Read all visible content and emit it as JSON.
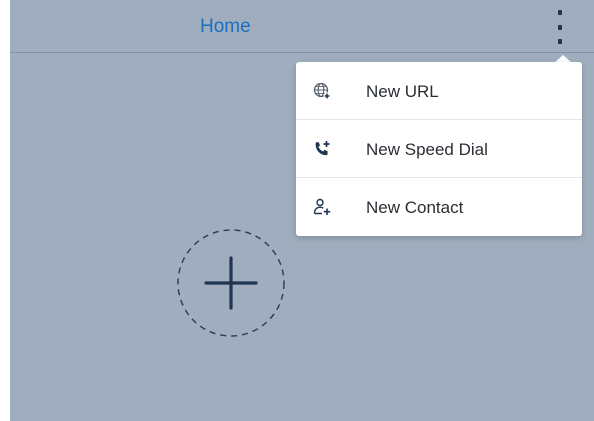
{
  "header": {
    "title": "Home",
    "more_icon": "vertical-ellipsis-icon"
  },
  "menu": {
    "items": [
      {
        "label": "New URL",
        "icon": "globe-plus-icon"
      },
      {
        "label": "New Speed Dial",
        "icon": "phone-plus-icon"
      },
      {
        "label": "New Contact",
        "icon": "contact-plus-icon"
      }
    ]
  },
  "main": {
    "add_icon": "plus-icon"
  },
  "colors": {
    "background": "#9fadbe",
    "accent": "#1a6fc2",
    "icon_dark": "#1f3550",
    "menu_bg": "#ffffff"
  }
}
